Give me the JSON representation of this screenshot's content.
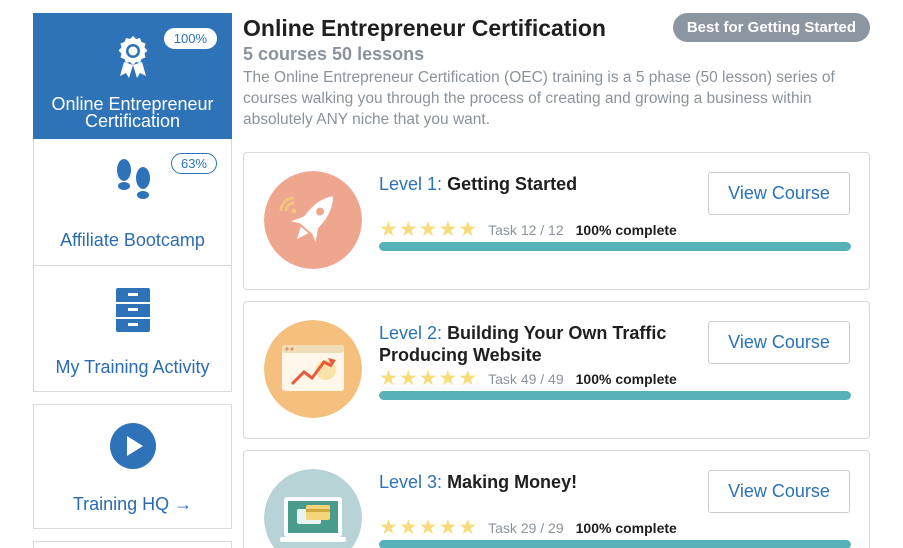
{
  "sidebar": {
    "items": [
      {
        "label": "Online Entrepreneur Certification",
        "percent": "100%",
        "icon": "award-ribbon-icon"
      },
      {
        "label": "Affiliate Bootcamp",
        "percent": "63%",
        "icon": "footprints-icon"
      },
      {
        "label": "My Training Activity",
        "icon": "file-cabinet-icon"
      },
      {
        "label": "Training HQ →",
        "icon": "play-circle-icon"
      }
    ]
  },
  "header": {
    "title": "Online Entrepreneur Certification",
    "subtitle": "5 courses 50 lessons",
    "description": "The Online Entrepreneur Certification (OEC) training is a 5 phase (50 lesson) series of courses walking you through the process of creating and growing a business within absolutely ANY niche that you want.",
    "badge": "Best for Getting Started"
  },
  "courses": [
    {
      "level": "Level 1:",
      "name": "Getting Started",
      "stars": "★★★★★",
      "task": "Task 12 / 12",
      "complete": "100% complete",
      "progress": 1.0,
      "button": "View Course",
      "icon": "rocket-icon",
      "color": "#efa68f"
    },
    {
      "level": "Level 2:",
      "name": "Building Your Own Traffic Producing Website",
      "stars": "★★★★★",
      "task": "Task 49 / 49",
      "complete": "100% complete",
      "progress": 1.0,
      "button": "View Course",
      "icon": "website-chart-icon",
      "color": "#f5c07e"
    },
    {
      "level": "Level 3:",
      "name": "Making Money!",
      "stars": "★★★★★",
      "task": "Task 29 / 29",
      "complete": "100% complete",
      "progress": 1.0,
      "button": "View Course",
      "icon": "monitor-card-icon",
      "color": "#b7d3d6"
    }
  ],
  "colors": {
    "accent": "#2e72b8",
    "progress": "#56b1b9",
    "stars": "#f7dc7c"
  }
}
